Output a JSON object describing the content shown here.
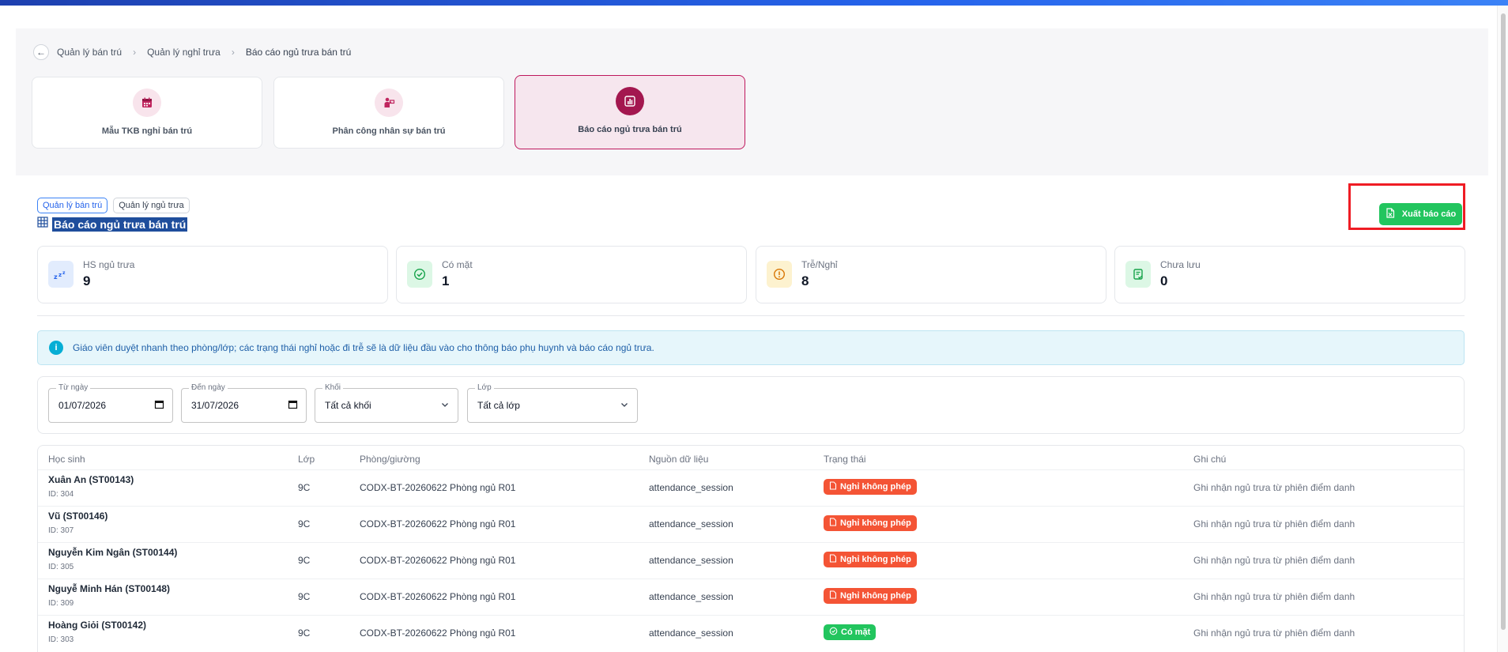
{
  "breadcrumb": {
    "items": [
      "Quản lý bán trú",
      "Quản lý nghỉ trưa",
      "Báo cáo ngủ trưa bán trú"
    ]
  },
  "module_tabs": [
    {
      "label": "Mẫu TKB nghỉ bán trú",
      "icon": "calendar-icon",
      "active": false
    },
    {
      "label": "Phân công nhân sự bán trú",
      "icon": "teacher-icon",
      "active": false
    },
    {
      "label": "Báo cáo ngủ trưa bán trú",
      "icon": "report-chart-icon",
      "active": true
    }
  ],
  "tags": [
    "Quản lý bán trú",
    "Quản lý ngủ trưa"
  ],
  "page_title": "Báo cáo ngủ trưa bán trú",
  "export_button": "Xuất báo cáo",
  "stats": [
    {
      "label": "HS ngủ trưa",
      "value": "9",
      "icon": "sleep-zzz-icon",
      "color": "#3b82f6"
    },
    {
      "label": "Có mặt",
      "value": "1",
      "icon": "check-circle-icon",
      "color": "#22c55e"
    },
    {
      "label": "Trễ/Nghỉ",
      "value": "8",
      "icon": "alert-circle-icon",
      "color": "#f59e0b"
    },
    {
      "label": "Chưa lưu",
      "value": "0",
      "icon": "unsaved-doc-icon",
      "color": "#22c55e"
    }
  ],
  "info_message": "Giáo viên duyệt nhanh theo phòng/lớp; các trạng thái nghỉ hoặc đi trễ sẽ là dữ liệu đầu vào cho thông báo phụ huynh và báo cáo ngủ trưa.",
  "filters": {
    "from_date": {
      "label": "Từ ngày",
      "value": "01/07/2026"
    },
    "to_date": {
      "label": "Đến ngày",
      "value": "31/07/2026"
    },
    "grade": {
      "label": "Khối",
      "value": "Tất cả khối"
    },
    "class": {
      "label": "Lớp",
      "value": "Tất cả lớp"
    }
  },
  "table": {
    "columns": [
      "Học sinh",
      "Lớp",
      "Phòng/giường",
      "Nguồn dữ liệu",
      "Trạng thái",
      "Ghi chú"
    ],
    "rows": [
      {
        "name": "Xuân An (ST00143)",
        "id": "ID: 304",
        "class": "9C",
        "room": "CODX-BT-20260622 Phòng ngủ R01",
        "source": "attendance_session",
        "status": "Nghỉ không phép",
        "status_type": "absent",
        "note": "Ghi nhận ngủ trưa từ phiên điểm danh"
      },
      {
        "name": "Vũ (ST00146)",
        "id": "ID: 307",
        "class": "9C",
        "room": "CODX-BT-20260622 Phòng ngủ R01",
        "source": "attendance_session",
        "status": "Nghỉ không phép",
        "status_type": "absent",
        "note": "Ghi nhận ngủ trưa từ phiên điểm danh"
      },
      {
        "name": "Nguyễn Kim Ngân (ST00144)",
        "id": "ID: 305",
        "class": "9C",
        "room": "CODX-BT-20260622 Phòng ngủ R01",
        "source": "attendance_session",
        "status": "Nghỉ không phép",
        "status_type": "absent",
        "note": "Ghi nhận ngủ trưa từ phiên điểm danh"
      },
      {
        "name": "Nguyễ Minh Hán (ST00148)",
        "id": "ID: 309",
        "class": "9C",
        "room": "CODX-BT-20260622 Phòng ngủ R01",
        "source": "attendance_session",
        "status": "Nghỉ không phép",
        "status_type": "absent",
        "note": "Ghi nhận ngủ trưa từ phiên điểm danh"
      },
      {
        "name": "Hoàng Giỏi (ST00142)",
        "id": "ID: 303",
        "class": "9C",
        "room": "CODX-BT-20260622 Phòng ngủ R01",
        "source": "attendance_session",
        "status": "Có mặt",
        "status_type": "present",
        "note": "Ghi nhận ngủ trưa từ phiên điểm danh"
      }
    ]
  }
}
